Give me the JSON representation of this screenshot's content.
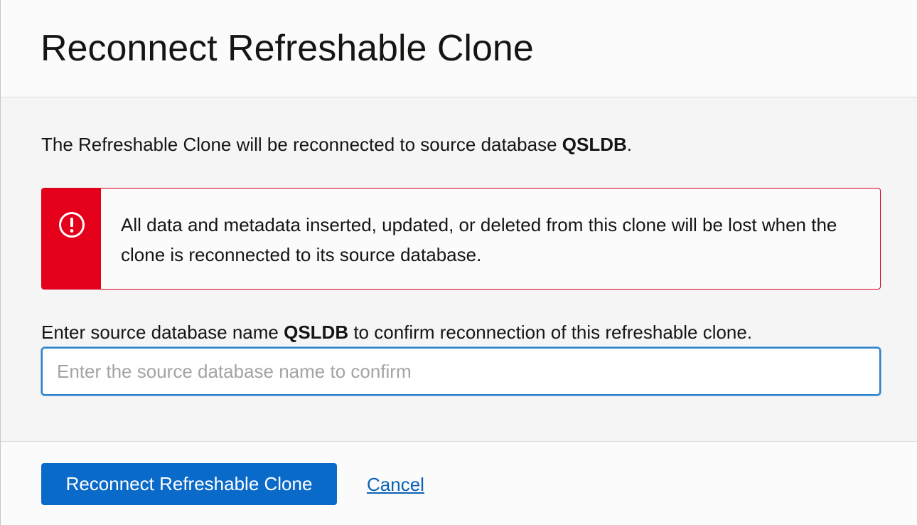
{
  "dialog": {
    "title": "Reconnect Refreshable Clone"
  },
  "body": {
    "intro_prefix": "The Refreshable Clone will be reconnected to source database ",
    "intro_db": "QSLDB",
    "intro_suffix": ".",
    "alert": {
      "icon": "exclamation-circle-icon",
      "color": "#e4001a",
      "text": "All data and metadata inserted, updated, or deleted from this clone will be lost when the clone is reconnected to its source database."
    },
    "confirm": {
      "label_prefix": "Enter source database name ",
      "label_db": "QSLDB",
      "label_suffix": " to confirm reconnection of this refreshable clone.",
      "value": "",
      "placeholder": "Enter the source database name to confirm"
    }
  },
  "footer": {
    "primary_label": "Reconnect Refreshable Clone",
    "primary_color": "#0a6ac9",
    "cancel_label": "Cancel"
  }
}
